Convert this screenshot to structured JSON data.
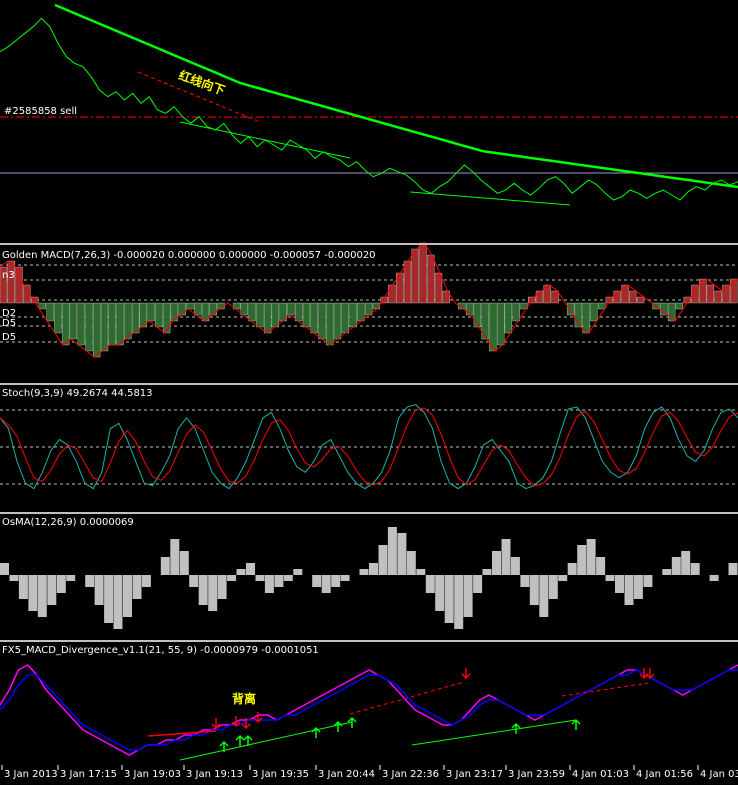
{
  "colors": {
    "background": "#000000",
    "price": "#00ff00",
    "ma": "#00ff00",
    "sell_line": "#ff0000",
    "macd_pos": "#a52a2a",
    "macd_neg": "#2e6b2e",
    "macd_hist": "#ffffff",
    "signal": "#ff0000",
    "stoch_main": "#20b2aa",
    "stoch_signal": "#ff0000",
    "osma": "#c0c0c0",
    "div_fast": "#ff00ff",
    "div_slow": "#0000ff",
    "arrow_up": "#00ff00",
    "arrow_down": "#ff0000",
    "callout": "#ffff00"
  },
  "main": {
    "order_label": "#2585858 sell",
    "callout_top": "红线向下"
  },
  "panels": {
    "macd": {
      "header": "Golden MACD(7,26,3) -0.000020 0.000000 0.000000 -0.000057 -0.000020",
      "levels": [
        "n3",
        "D2",
        "D5",
        "D5"
      ]
    },
    "stoch": {
      "header": "Stoch(9,3,9) 49.2674 44.5813"
    },
    "osma": {
      "header": "OsMA(12,26,9) 0.0000069"
    },
    "divergence": {
      "header": "FX5_MACD_Divergence_v1.1(21, 55, 9) -0.0000979 -0.0001051",
      "callout": "背离"
    }
  },
  "chart_data": {
    "type": "line",
    "x_ticks": [
      "3 Jan 2013",
      "3 Jan 17:15",
      "3 Jan 19:03",
      "3 Jan 19:13",
      "3 Jan 19:35",
      "3 Jan 20:44",
      "3 Jan 22:36",
      "3 Jan 23:17",
      "3 Jan 23:59",
      "4 Jan 01:03",
      "4 Jan 01:56",
      "4 Jan 03:"
    ],
    "price_series": [
      {
        "name": "price",
        "values": [
          1.3135,
          1.3138,
          1.3142,
          1.3146,
          1.315,
          1.3155,
          1.315,
          1.314,
          1.3132,
          1.3128,
          1.3126,
          1.312,
          1.3112,
          1.3108,
          1.3111,
          1.3106,
          1.311,
          1.3104,
          1.3108,
          1.31,
          1.3098,
          1.3102,
          1.3096,
          1.3092,
          1.3096,
          1.309,
          1.3088,
          1.3092,
          1.3085,
          1.308,
          1.3084,
          1.3078,
          1.3082,
          1.3079,
          1.3076,
          1.3082,
          1.3079,
          1.3076,
          1.3071,
          1.3075,
          1.3072,
          1.307,
          1.3066,
          1.3069,
          1.3064,
          1.306,
          1.3062,
          1.3065,
          1.3063,
          1.3061,
          1.3057,
          1.3052,
          1.305,
          1.3054,
          1.3057,
          1.3062,
          1.3067,
          1.3063,
          1.3058,
          1.3054,
          1.305,
          1.3052,
          1.3056,
          1.3052,
          1.3049,
          1.3053,
          1.3058,
          1.306,
          1.3056,
          1.305,
          1.3054,
          1.3058,
          1.3055,
          1.305,
          1.3046,
          1.3048,
          1.3052,
          1.305,
          1.3047,
          1.305,
          1.3052,
          1.3049,
          1.3046,
          1.3051,
          1.3054,
          1.3052,
          1.3056,
          1.3058,
          1.3055,
          1.3057
        ]
      },
      {
        "name": "ma",
        "values": [
          1.316,
          1.3157,
          1.3154,
          1.3151,
          1.3148,
          1.3145,
          1.3142,
          1.3139,
          1.3136,
          1.3133,
          1.313,
          1.3127,
          1.3124,
          1.3121,
          1.3118,
          1.3115,
          1.3112,
          1.311,
          1.3108,
          1.3106,
          1.3104,
          1.3102,
          1.31,
          1.3098,
          1.3096,
          1.3094,
          1.3092,
          1.309,
          1.3088,
          1.3086,
          1.3084,
          1.3082,
          1.308,
          1.3078,
          1.3076,
          1.3074,
          1.3072,
          1.307,
          1.3069,
          1.3068,
          1.3067,
          1.3066,
          1.3065,
          1.3064,
          1.3063,
          1.3062,
          1.3061,
          1.306,
          1.3059,
          1.3058,
          1.3057,
          1.3056,
          1.3055,
          1.3054,
          1.3053,
          1.3052,
          1.3051,
          1.305,
          1.3049,
          1.3048
        ]
      }
    ],
    "macd_hist": [
      6,
      7,
      6,
      3,
      1,
      -1,
      -3,
      -5,
      -7,
      -6,
      -7,
      -8,
      -9,
      -8,
      -7,
      -7,
      -6,
      -5,
      -4,
      -3,
      -4,
      -5,
      -3,
      -2,
      -1,
      -2,
      -3,
      -2,
      -1,
      0,
      -1,
      -2,
      -3,
      -4,
      -5,
      -4,
      -3,
      -2,
      -3,
      -4,
      -5,
      -6,
      -7,
      -6,
      -5,
      -4,
      -3,
      -2,
      -1,
      1,
      3,
      5,
      7,
      9,
      10,
      8,
      5,
      2,
      0,
      -1,
      -2,
      -4,
      -6,
      -8,
      -7,
      -5,
      -3,
      -1,
      1,
      2,
      3,
      2,
      0,
      -2,
      -4,
      -5,
      -3,
      -1,
      1,
      2,
      3,
      2,
      1,
      0,
      -1,
      -2,
      -3,
      -1,
      1,
      3,
      4,
      3,
      2,
      3,
      4
    ],
    "stoch": [
      80,
      70,
      40,
      20,
      15,
      30,
      50,
      60,
      55,
      40,
      20,
      15,
      30,
      70,
      75,
      60,
      40,
      20,
      18,
      30,
      45,
      70,
      80,
      70,
      50,
      30,
      20,
      15,
      25,
      40,
      60,
      80,
      85,
      70,
      50,
      35,
      30,
      40,
      55,
      60,
      45,
      30,
      20,
      15,
      20,
      30,
      50,
      80,
      90,
      92,
      85,
      70,
      40,
      20,
      15,
      20,
      35,
      55,
      60,
      50,
      40,
      20,
      15,
      18,
      25,
      40,
      65,
      88,
      90,
      80,
      60,
      40,
      30,
      25,
      30,
      45,
      70,
      85,
      90,
      80,
      60,
      45,
      40,
      50,
      70,
      85,
      88,
      80
    ],
    "osma": [
      2,
      -1,
      -4,
      -6,
      -7,
      -5,
      -3,
      -1,
      0,
      -2,
      -5,
      -8,
      -9,
      -7,
      -4,
      -2,
      0,
      3,
      6,
      4,
      -2,
      -5,
      -6,
      -4,
      -1,
      1,
      2,
      -1,
      -3,
      -2,
      -1,
      1,
      0,
      -2,
      -3,
      -2,
      -1,
      0,
      1,
      2,
      5,
      8,
      7,
      4,
      1,
      -3,
      -6,
      -8,
      -9,
      -7,
      -3,
      1,
      4,
      6,
      3,
      -2,
      -5,
      -7,
      -4,
      -1,
      2,
      5,
      6,
      3,
      -1,
      -3,
      -5,
      -4,
      -2,
      0,
      1,
      3,
      4,
      2,
      0,
      -1,
      0,
      2
    ],
    "divergence": {
      "fast": [
        2,
        5,
        9,
        10,
        8,
        5,
        3,
        1,
        -1,
        -3,
        -4,
        -5,
        -6,
        -7,
        -8,
        -7,
        -6,
        -6,
        -5,
        -5,
        -4,
        -4,
        -3,
        -3,
        -2,
        -2,
        -1,
        -1,
        0,
        0,
        -1,
        0,
        1,
        2,
        3,
        4,
        5,
        6,
        7,
        8,
        9,
        8,
        7,
        5,
        3,
        1,
        0,
        -1,
        -2,
        -2,
        -1,
        1,
        3,
        4,
        3,
        2,
        1,
        0,
        -1,
        0,
        1,
        2,
        3,
        4,
        5,
        6,
        7,
        8,
        9,
        9,
        8,
        7,
        6,
        5,
        4,
        5,
        6,
        7,
        8,
        9,
        10
      ],
      "slow": [
        1,
        3,
        6,
        8,
        8,
        6,
        4,
        2,
        0,
        -2,
        -3,
        -4,
        -5,
        -6,
        -7,
        -7,
        -6,
        -6,
        -6,
        -5,
        -5,
        -4,
        -4,
        -3,
        -3,
        -2,
        -2,
        -1,
        -1,
        -1,
        -1,
        0,
        0,
        1,
        2,
        3,
        4,
        5,
        6,
        7,
        8,
        8,
        7,
        6,
        4,
        2,
        1,
        0,
        -1,
        -2,
        -1,
        0,
        2,
        3,
        3,
        2,
        1,
        0,
        0,
        0,
        1,
        2,
        3,
        4,
        5,
        6,
        7,
        8,
        8,
        9,
        8,
        7,
        6,
        5,
        5,
        5,
        6,
        7,
        8,
        9,
        9
      ]
    }
  }
}
